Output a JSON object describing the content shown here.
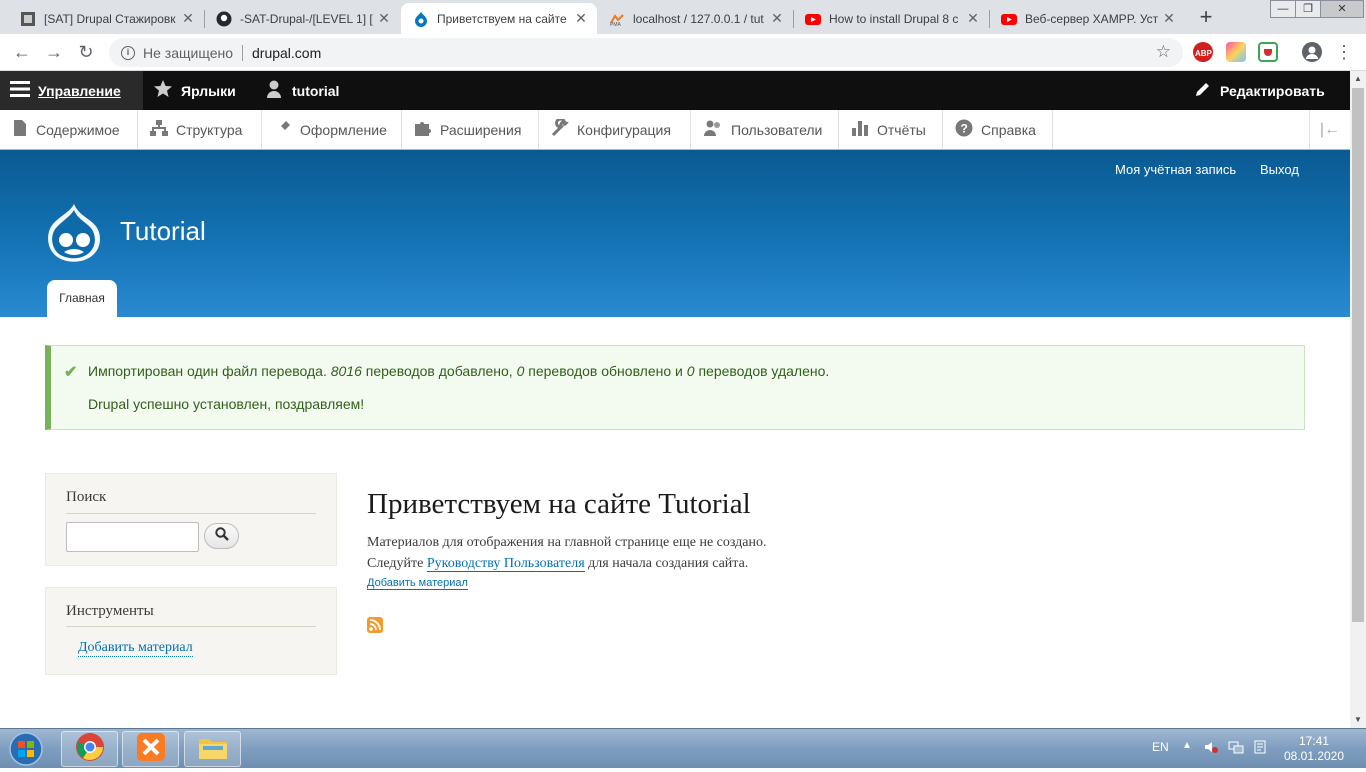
{
  "browser": {
    "tabs": [
      {
        "title": "[SAT] Drupal Стажировк",
        "icon": "sat-favicon"
      },
      {
        "title": "-SAT-Drupal-/[LEVEL 1] [",
        "icon": "github-icon"
      },
      {
        "title": "Приветствуем на сайте",
        "icon": "drupal-favicon",
        "active": true
      },
      {
        "title": "localhost / 127.0.0.1 / tut",
        "icon": "phpmyadmin-icon"
      },
      {
        "title": "How to install Drupal 8 c",
        "icon": "youtube-icon"
      },
      {
        "title": "Веб-сервер XAMPP. Уст",
        "icon": "youtube-icon"
      }
    ],
    "close_glyph": "✕",
    "new_tab_glyph": "+",
    "security_label": "Не защищено",
    "url": "drupal.com",
    "extensions": [
      "abp-icon",
      "color-ext-icon",
      "shield-ext-icon",
      "profile-icon",
      "menu-icon"
    ]
  },
  "admin_toolbar": {
    "manage": "Управление",
    "shortcuts": "Ярлыки",
    "user": "tutorial",
    "edit": "Редактировать"
  },
  "admin_tray": {
    "items": [
      "Содержимое",
      "Структура",
      "Оформление",
      "Расширения",
      "Конфигурация",
      "Пользователи",
      "Отчёты",
      "Справка"
    ]
  },
  "header": {
    "my_account": "Моя учётная запись",
    "logout": "Выход",
    "site_name": "Tutorial",
    "home_tab": "Главная"
  },
  "message": {
    "line1_a": "Импортирован один файл перевода.",
    "count_added": "8016",
    "line1_b": "переводов добавлено,",
    "count_updated": "0",
    "line1_c": "переводов обновлено и",
    "count_deleted": "0",
    "line1_d": "переводов удалено.",
    "line2": "Drupal успешно установлен, поздравляем!"
  },
  "sidebar": {
    "search_title": "Поиск",
    "search_value": "",
    "tools_title": "Инструменты",
    "tools_link": "Добавить материал"
  },
  "main": {
    "title": "Приветствуем на сайте Tutorial",
    "p1": "Материалов для отображения на главной странице еще не создано.",
    "p2_a": "Следуйте",
    "p2_link": "Руководству Пользователя",
    "p2_b": "для начала создания сайта.",
    "add_link": "Добавить материал"
  },
  "taskbar": {
    "lang": "EN",
    "time": "17:41",
    "date": "08.01.2020"
  }
}
